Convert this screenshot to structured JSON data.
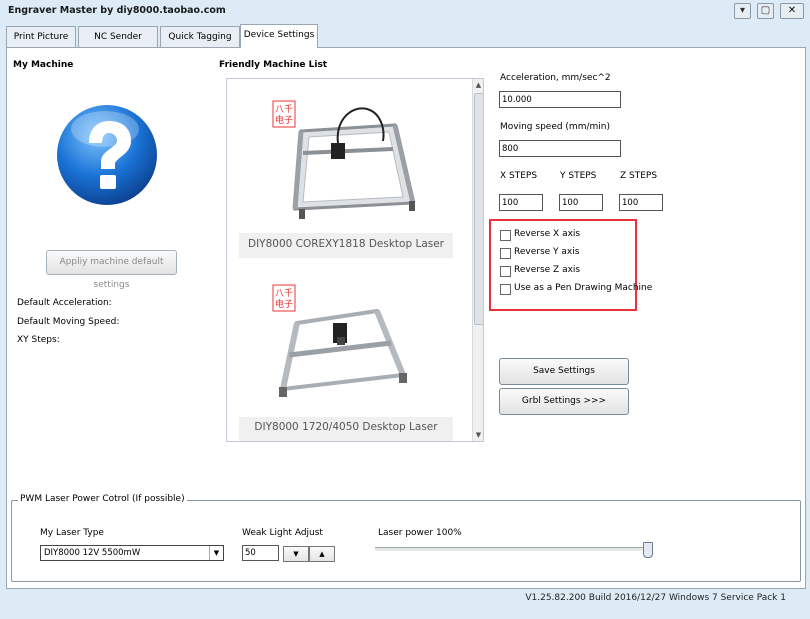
{
  "window": {
    "title": "Engraver Master by diy8000.taobao.com",
    "controls": {
      "minimize": "▾",
      "maximize": "▢",
      "close": "✕"
    }
  },
  "tabs": [
    "Print Picture",
    "NC Sender",
    "Quick Tagging",
    "Device Settings"
  ],
  "active_tab": "Device Settings",
  "my_machine": {
    "heading": "My Machine",
    "apply_button": "Appliy machine default settings",
    "default_acceleration_label": "Default Acceleration:",
    "default_moving_speed_label": "Default Moving Speed:",
    "xy_steps_label": "XY Steps:"
  },
  "machine_list": {
    "heading": "Friendly Machine List",
    "items": [
      {
        "name": "DIY8000 COREXY1818 Desktop Laser",
        "logo": "八千\n电子"
      },
      {
        "name": "DIY8000 1720/4050 Desktop Laser",
        "logo": "八千\n电子"
      }
    ]
  },
  "settings": {
    "acceleration_label": "Acceleration, mm/sec^2",
    "acceleration_value": "10.000",
    "moving_speed_label": "Moving speed  (mm/min)",
    "moving_speed_value": "800",
    "x_steps_label": "X STEPS",
    "x_steps_value": "100",
    "y_steps_label": "Y STEPS",
    "y_steps_value": "100",
    "z_steps_label": "Z STEPS",
    "z_steps_value": "100",
    "checkboxes": [
      {
        "label": "Reverse X axis",
        "checked": false
      },
      {
        "label": "Reverse Y axis",
        "checked": false
      },
      {
        "label": "Reverse Z axis",
        "checked": false
      },
      {
        "label": "Use as a Pen Drawing Machine",
        "checked": false
      }
    ],
    "save_button": "Save Settings",
    "grbl_button": "Grbl Settings >>>"
  },
  "pwm": {
    "legend": "PWM Laser Power Cotrol (If possible)",
    "laser_type_label": "My Laser Type",
    "laser_type_value": "DIY8000 12V 5500mW",
    "weak_light_label": "Weak Light Adjust",
    "weak_light_value": "50",
    "laser_power_label": "Laser power 100%",
    "laser_power_fraction": 1.0
  },
  "footer": {
    "version": "V1.25.82.200 Build 2016/12/27 Windows 7 Service Pack 1"
  },
  "colors": {
    "highlight_border": "#e8333b",
    "help_icon": "#1a73d6",
    "window_bg": "#dcebf5"
  }
}
